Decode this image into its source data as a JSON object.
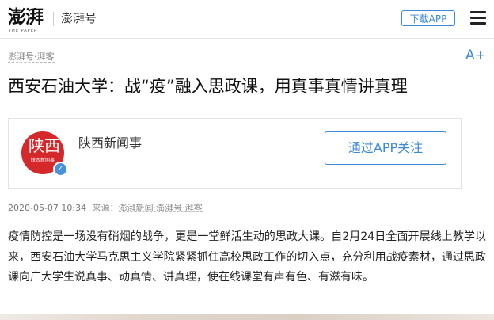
{
  "header": {
    "logo_text": "澎湃",
    "logo_sub": "THE PAPER",
    "section_name": "澎湃号",
    "download_label": "下载APP",
    "menu_icon": "hamburger-menu-icon"
  },
  "article": {
    "source_tag": "澎湃号·湃客",
    "font_size_label": "A+",
    "title": "西安石油大学：战“疫”融入思政课，用真事真情讲真理",
    "author": {
      "name": "陕西新闻事",
      "avatar_text": "陕西",
      "avatar_sub": "陕西新闻事",
      "verified_icon": "verified-badge-icon",
      "follow_label": "通过APP关注"
    },
    "meta": {
      "datetime": "2020-05-07 10:34",
      "source_label": "来源：",
      "source_value": "澎湃新闻·澎湃号·湃客"
    },
    "body": "疫情防控是一场没有硝烟的战争，更是一堂鲜活生动的思政大课。自2月24日全面开展线上教学以来，西安石油大学马克思主义学院紧紧抓住高校思政工作的切入点，充分利用战疫素材，通过思政课向广大学生说真事、动真情、讲真理，使在线课堂有声有色、有滋有味。"
  }
}
